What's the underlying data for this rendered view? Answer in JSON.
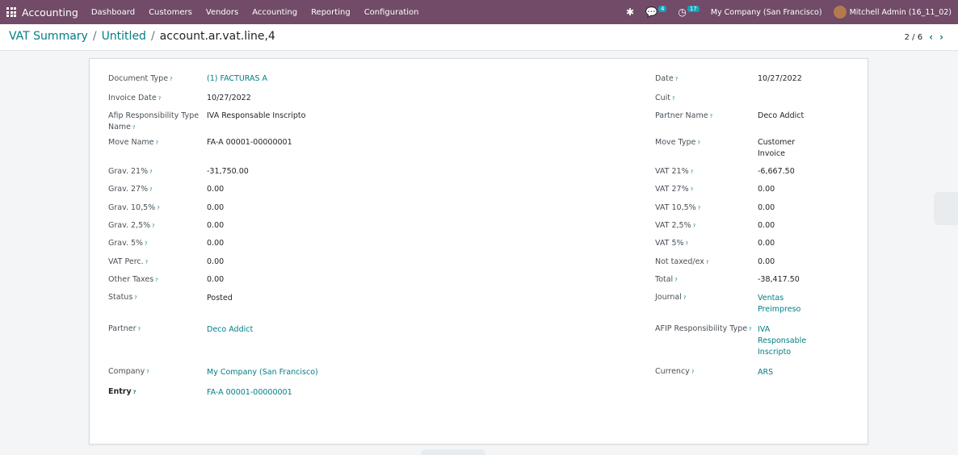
{
  "navbar": {
    "app_name": "Accounting",
    "menu": [
      "Dashboard",
      "Customers",
      "Vendors",
      "Accounting",
      "Reporting",
      "Configuration"
    ],
    "chat_badge": "4",
    "activity_badge": "17",
    "company": "My Company (San Francisco)",
    "user": "Mitchell Admin (16_11_02)",
    "accent_color": "#714b67"
  },
  "breadcrumb": {
    "level1": "VAT Summary",
    "separator": "/",
    "level2": "Untitled",
    "current": "account.ar.vat.line,4"
  },
  "pager": {
    "value": "2 / 6",
    "prev_icon": "chevron-left-icon",
    "next_icon": "chevron-right-icon"
  },
  "form": {
    "left": [
      {
        "label": "Document Type",
        "value": "(1) FACTURAS A",
        "link": true
      },
      {
        "label": "Invoice Date",
        "value": "10/27/2022"
      },
      {
        "label": "Afip Responsibility Type Name",
        "value": "IVA Responsable Inscripto"
      },
      {
        "label": "Move Name",
        "value": "FA-A 00001-00000001"
      },
      {
        "label": "Grav. 21%",
        "value": "-31,750.00"
      },
      {
        "label": "Grav. 27%",
        "value": "0.00"
      },
      {
        "label": "Grav. 10,5%",
        "value": "0.00"
      },
      {
        "label": "Grav. 2,5%",
        "value": "0.00"
      },
      {
        "label": "Grav. 5%",
        "value": "0.00"
      },
      {
        "label": "VAT Perc.",
        "value": "0.00"
      },
      {
        "label": "Other Taxes",
        "value": "0.00"
      },
      {
        "label": "Status",
        "value": "Posted"
      },
      {
        "label": "Partner",
        "value": "Deco Addict",
        "link": true
      },
      {
        "label": "Company",
        "value": "My Company (San Francisco)",
        "link": true
      },
      {
        "label": "Entry",
        "value": "FA-A 00001-00000001",
        "link": true
      }
    ],
    "right": [
      {
        "label": "Date",
        "value": "10/27/2022"
      },
      {
        "label": "Cuit",
        "value": ""
      },
      {
        "label": "Partner Name",
        "value": "Deco Addict"
      },
      {
        "label": "Move Type",
        "value": "Customer Invoice"
      },
      {
        "label": "VAT 21%",
        "value": "-6,667.50"
      },
      {
        "label": "VAT 27%",
        "value": "0.00"
      },
      {
        "label": "VAT 10,5%",
        "value": "0.00"
      },
      {
        "label": "VAT 2,5%",
        "value": "0.00"
      },
      {
        "label": "VAT 5%",
        "value": "0.00"
      },
      {
        "label": "Not taxed/ex",
        "value": "0.00"
      },
      {
        "label": "Total",
        "value": "-38,417.50"
      },
      {
        "label": "Journal",
        "value": "Ventas Preimpreso",
        "link": true
      },
      {
        "label": "AFIP Responsibility Type",
        "value": "IVA Responsable Inscripto",
        "link": true
      },
      {
        "label": "Currency",
        "value": "ARS",
        "link": true
      }
    ],
    "help_marker": "?"
  }
}
